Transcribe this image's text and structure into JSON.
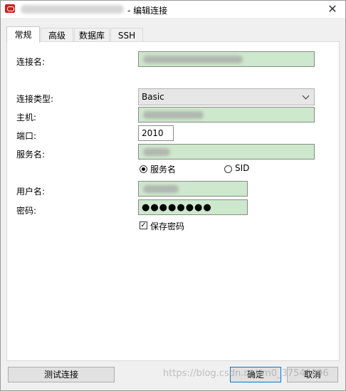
{
  "window": {
    "title": "- 编辑连接",
    "close_icon": "close-icon"
  },
  "tabs": [
    {
      "label": "常规",
      "active": true
    },
    {
      "label": "高级",
      "active": false
    },
    {
      "label": "数据库",
      "active": false
    },
    {
      "label": "SSH",
      "active": false
    }
  ],
  "form": {
    "connection_name_label": "连接名:",
    "connection_type_label": "连接类型:",
    "connection_type_value": "Basic",
    "host_label": "主机:",
    "port_label": "端口:",
    "port_value": "2010",
    "service_name_label": "服务名:",
    "radio_service_name": "服务名",
    "radio_sid": "SID",
    "username_label": "用户名:",
    "password_label": "密码:",
    "password_value": "●●●●●●●●",
    "save_password_label": "保存密码",
    "save_password_checked": true
  },
  "buttons": {
    "test_connection": "测试连接",
    "ok": "确定",
    "cancel": "取消"
  },
  "watermark": "https://blog.csdn.net/m0_37540696"
}
